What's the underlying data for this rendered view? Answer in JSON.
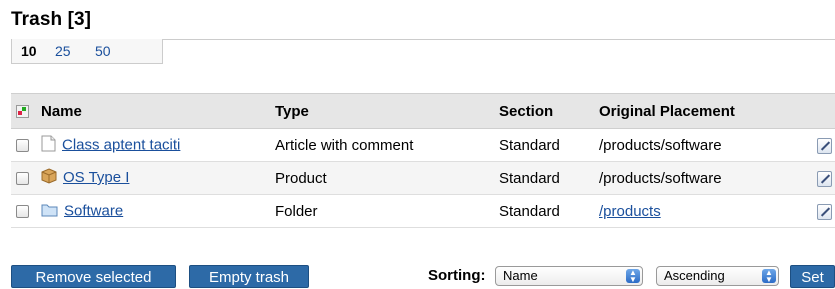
{
  "page": {
    "title": "Trash [3]"
  },
  "paging": {
    "current": "10",
    "options": [
      "25",
      "50"
    ]
  },
  "table": {
    "headers": {
      "name": "Name",
      "type": "Type",
      "section": "Section",
      "placement": "Original Placement"
    },
    "rows": [
      {
        "name": "Class aptent taciti",
        "type": "Article with comment",
        "section": "Standard",
        "placement": "/products/software",
        "icon": "document-icon",
        "placement_link": false
      },
      {
        "name": "OS Type I",
        "type": "Product",
        "section": "Standard",
        "placement": "/products/software",
        "icon": "product-box-icon",
        "placement_link": false
      },
      {
        "name": "Software",
        "type": "Folder",
        "section": "Standard",
        "placement": "/products",
        "icon": "folder-icon",
        "placement_link": true
      }
    ]
  },
  "actions": {
    "remove_selected": "Remove selected",
    "empty_trash": "Empty trash"
  },
  "sorting": {
    "label": "Sorting:",
    "field": "Name",
    "order": "Ascending",
    "set": "Set"
  },
  "colors": {
    "button": "#2d6aa7",
    "link": "#1a4f9c",
    "header_bg": "#e6e6e6"
  }
}
